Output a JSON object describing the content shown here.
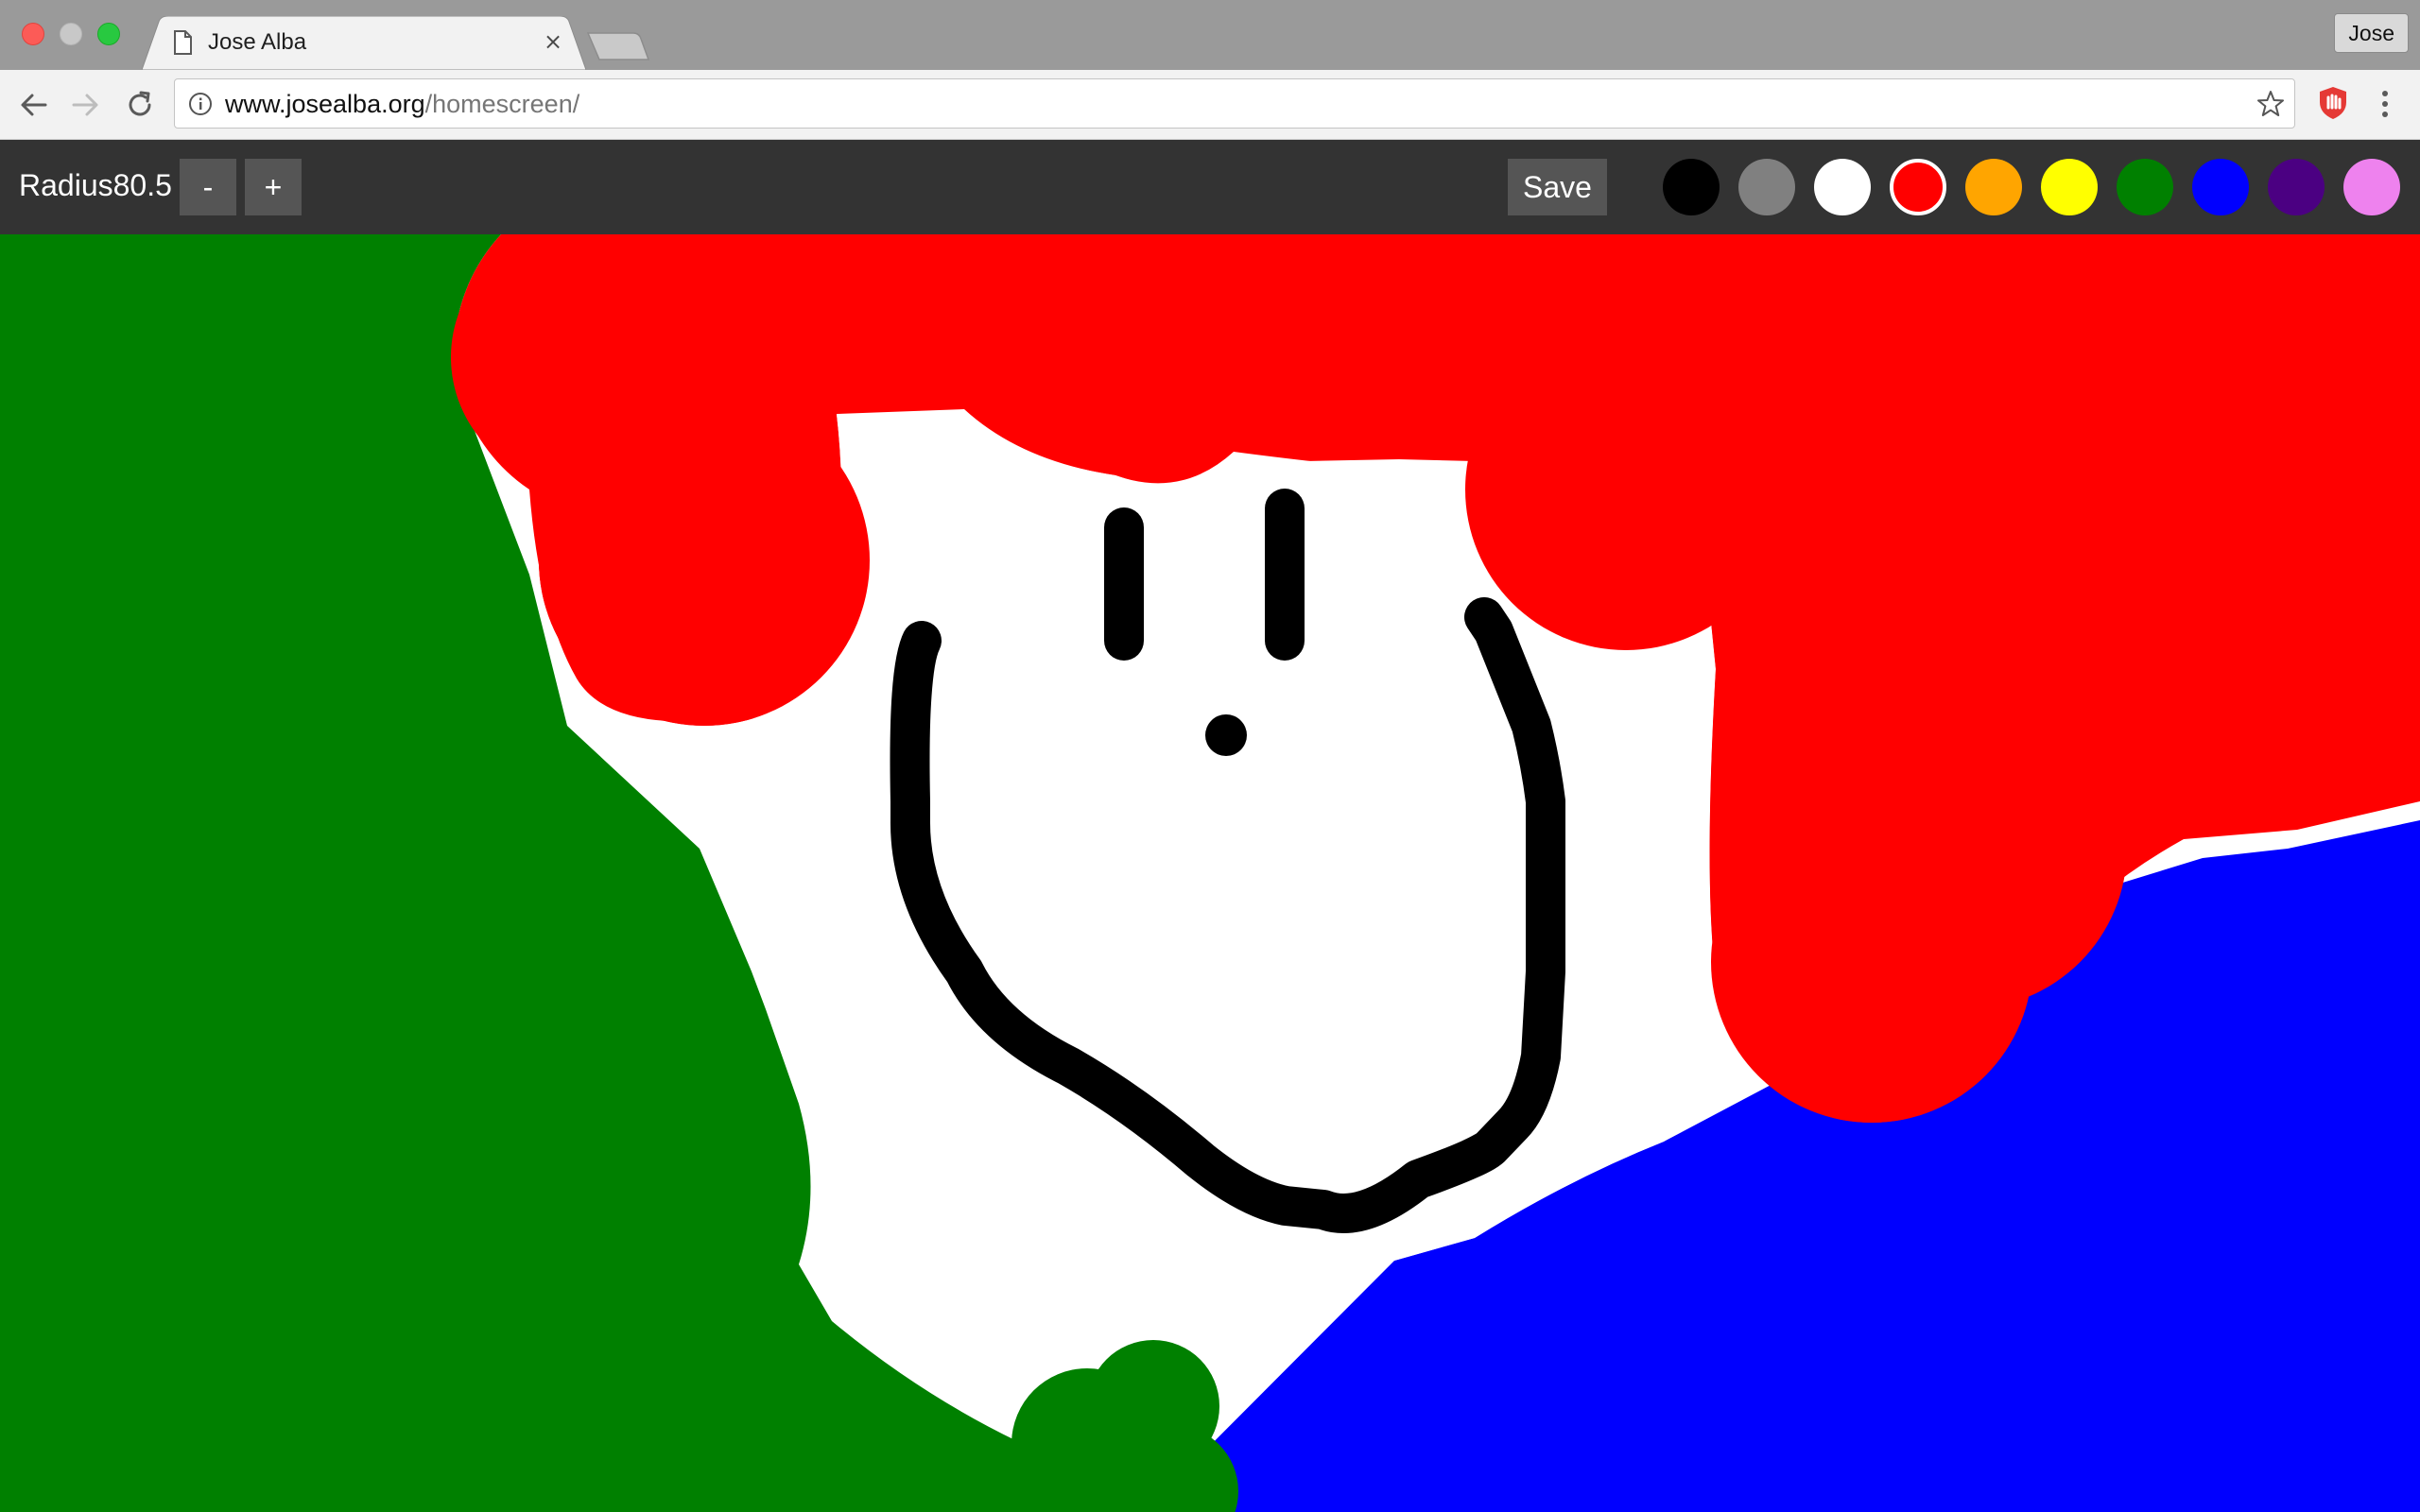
{
  "browser": {
    "tab": {
      "title": "Jose Alba",
      "close_glyph": "×"
    },
    "profile_name": "Jose",
    "address_bar": {
      "host": "www.josealba.org",
      "path": "/homescreen/"
    },
    "icons": [
      "back-arrow-icon",
      "forward-arrow-icon",
      "reload-icon",
      "info-icon",
      "bookmark-star-icon",
      "extension-shield-icon",
      "kebab-menu-icon",
      "page-icon"
    ]
  },
  "app": {
    "radius_label": "Radius",
    "radius_value": "80.5",
    "minus_label": "-",
    "plus_label": "+",
    "save_label": "Save",
    "palette": [
      {
        "name": "black",
        "color": "#000000",
        "selected": false
      },
      {
        "name": "gray",
        "color": "#808080",
        "selected": false
      },
      {
        "name": "white",
        "color": "#ffffff",
        "selected": false
      },
      {
        "name": "red",
        "color": "#ff0000",
        "selected": true
      },
      {
        "name": "orange",
        "color": "#ffa500",
        "selected": false
      },
      {
        "name": "yellow",
        "color": "#ffff00",
        "selected": false
      },
      {
        "name": "green",
        "color": "#008000",
        "selected": false
      },
      {
        "name": "blue",
        "color": "#0000ff",
        "selected": false
      },
      {
        "name": "indigo",
        "color": "#4b0082",
        "selected": false
      },
      {
        "name": "violet",
        "color": "#ee82ee",
        "selected": false
      }
    ]
  },
  "drawing": {
    "description_colors": {
      "green": "#008000",
      "red": "#ff0000",
      "blue": "#0000ff",
      "black": "#000000",
      "white": "#ffffff"
    }
  }
}
